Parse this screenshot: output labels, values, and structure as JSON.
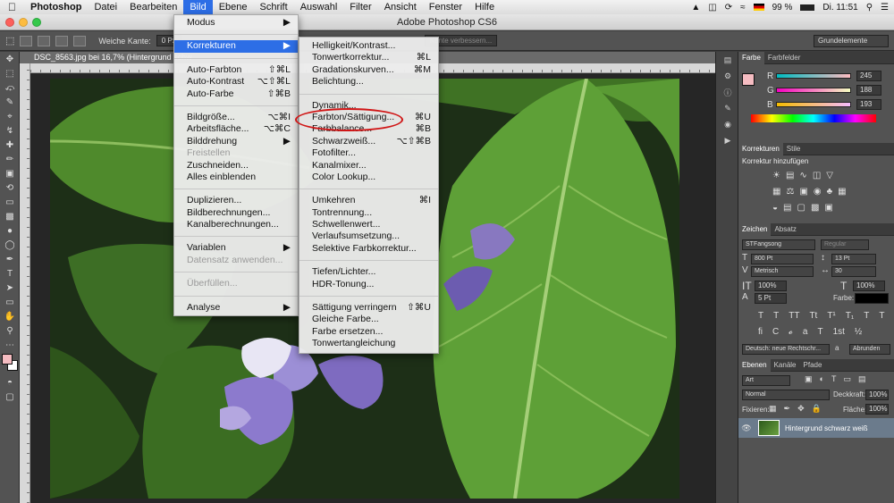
{
  "menubar": {
    "apple": "",
    "app": "Photoshop",
    "items": [
      "Datei",
      "Bearbeiten",
      "Bild",
      "Ebene",
      "Schrift",
      "Auswahl",
      "Filter",
      "Ansicht",
      "Fenster",
      "Hilfe"
    ],
    "active_index": 2,
    "battery": "99 %",
    "time": "Di. 11:51",
    "status_icons": [
      "drive-icon",
      "shield-icon",
      "sync-icon",
      "wifi-icon",
      "flag-de-icon",
      "battery-icon",
      "search-icon",
      "menu-list-icon"
    ]
  },
  "window": {
    "title": "Adobe Photoshop CS6"
  },
  "options": {
    "weiche_kante_label": "Weiche Kante:",
    "weiche_kante_value": "0 Px",
    "kante_verbessern": "Kante verbessern...",
    "workspace": "Grundelemente"
  },
  "document": {
    "tab_title": "DSC_8563.jpg bei 16,7% (Hintergrund schw"
  },
  "bild_menu": {
    "items": [
      {
        "label": "Modus",
        "shortcut": "▶",
        "type": "item"
      },
      {
        "type": "sep"
      },
      {
        "label": "Korrekturen",
        "shortcut": "▶",
        "type": "hl"
      },
      {
        "type": "sep"
      },
      {
        "label": "Auto-Farbton",
        "shortcut": "⇧⌘L",
        "type": "item"
      },
      {
        "label": "Auto-Kontrast",
        "shortcut": "⌥⇧⌘L",
        "type": "item"
      },
      {
        "label": "Auto-Farbe",
        "shortcut": "⇧⌘B",
        "type": "item"
      },
      {
        "type": "sep"
      },
      {
        "label": "Bildgröße...",
        "shortcut": "⌥⌘I",
        "type": "item"
      },
      {
        "label": "Arbeitsfläche...",
        "shortcut": "⌥⌘C",
        "type": "item"
      },
      {
        "label": "Bilddrehung",
        "shortcut": "▶",
        "type": "item"
      },
      {
        "label": "Freistellen",
        "shortcut": "",
        "type": "dis"
      },
      {
        "label": "Zuschneiden...",
        "shortcut": "",
        "type": "item"
      },
      {
        "label": "Alles einblenden",
        "shortcut": "",
        "type": "item"
      },
      {
        "type": "sep"
      },
      {
        "label": "Duplizieren...",
        "shortcut": "",
        "type": "item"
      },
      {
        "label": "Bildberechnungen...",
        "shortcut": "",
        "type": "item"
      },
      {
        "label": "Kanalberechnungen...",
        "shortcut": "",
        "type": "item"
      },
      {
        "type": "sep"
      },
      {
        "label": "Variablen",
        "shortcut": "▶",
        "type": "item"
      },
      {
        "label": "Datensatz anwenden...",
        "shortcut": "",
        "type": "dis"
      },
      {
        "type": "sep"
      },
      {
        "label": "Überfüllen...",
        "shortcut": "",
        "type": "dis"
      },
      {
        "type": "sep"
      },
      {
        "label": "Analyse",
        "shortcut": "▶",
        "type": "item"
      }
    ]
  },
  "korrekturen_menu": {
    "items": [
      {
        "label": "Helligkeit/Kontrast...",
        "shortcut": "",
        "type": "item"
      },
      {
        "label": "Tonwertkorrektur...",
        "shortcut": "⌘L",
        "type": "item"
      },
      {
        "label": "Gradationskurven...",
        "shortcut": "⌘M",
        "type": "item"
      },
      {
        "label": "Belichtung...",
        "shortcut": "",
        "type": "item"
      },
      {
        "type": "sep"
      },
      {
        "label": "Dynamik...",
        "shortcut": "",
        "type": "item"
      },
      {
        "label": "Farbton/Sättigung...",
        "shortcut": "⌘U",
        "type": "item"
      },
      {
        "label": "Farbbalance...",
        "shortcut": "⌘B",
        "type": "item"
      },
      {
        "label": "Schwarzweiß...",
        "shortcut": "⌥⇧⌘B",
        "type": "item"
      },
      {
        "label": "Fotofilter...",
        "shortcut": "",
        "type": "item"
      },
      {
        "label": "Kanalmixer...",
        "shortcut": "",
        "type": "item"
      },
      {
        "label": "Color Lookup...",
        "shortcut": "",
        "type": "item"
      },
      {
        "type": "sep"
      },
      {
        "label": "Umkehren",
        "shortcut": "⌘I",
        "type": "item"
      },
      {
        "label": "Tontrennung...",
        "shortcut": "",
        "type": "item"
      },
      {
        "label": "Schwellenwert...",
        "shortcut": "",
        "type": "item"
      },
      {
        "label": "Verlaufsumsetzung...",
        "shortcut": "",
        "type": "item"
      },
      {
        "label": "Selektive Farbkorrektur...",
        "shortcut": "",
        "type": "item"
      },
      {
        "type": "sep"
      },
      {
        "label": "Tiefen/Lichter...",
        "shortcut": "",
        "type": "item"
      },
      {
        "label": "HDR-Tonung...",
        "shortcut": "",
        "type": "item"
      },
      {
        "type": "sep"
      },
      {
        "label": "Sättigung verringern",
        "shortcut": "⇧⌘U",
        "type": "item"
      },
      {
        "label": "Gleiche Farbe...",
        "shortcut": "",
        "type": "item"
      },
      {
        "label": "Farbe ersetzen...",
        "shortcut": "",
        "type": "item"
      },
      {
        "label": "Tonwertangleichung",
        "shortcut": "",
        "type": "item"
      }
    ]
  },
  "color_panel": {
    "tabs": [
      "Farbe",
      "Farbfelder"
    ],
    "r_label": "R",
    "g_label": "G",
    "b_label": "B",
    "r": "245",
    "g": "188",
    "b": "193",
    "fg_color": "#f5bcc1"
  },
  "adjust_panel": {
    "tabs": [
      "Korrekturen",
      "Stile"
    ],
    "heading": "Korrektur hinzufügen"
  },
  "char_panel": {
    "tabs": [
      "Zeichen",
      "Absatz"
    ],
    "font": "STFangsong",
    "style": "Regular",
    "size": "800 Pt",
    "leading": "13 Pt",
    "kerning": "Metrisch",
    "tracking": "30",
    "vscale": "100%",
    "hscale": "100%",
    "baseline": "5 Pt",
    "color_label": "Farbe:",
    "language": "Deutsch: neue Rechtschr...",
    "aa": "Abrunden"
  },
  "layers_panel": {
    "tabs": [
      "Ebenen",
      "Kanäle",
      "Pfade"
    ],
    "filter": "Art",
    "blend": "Normal",
    "opacity_label": "Deckkraft:",
    "opacity": "100%",
    "lock_label": "Fixieren:",
    "fill_label": "Fläche:",
    "fill": "100%",
    "layer_name": "Hintergrund schwarz weiß"
  }
}
